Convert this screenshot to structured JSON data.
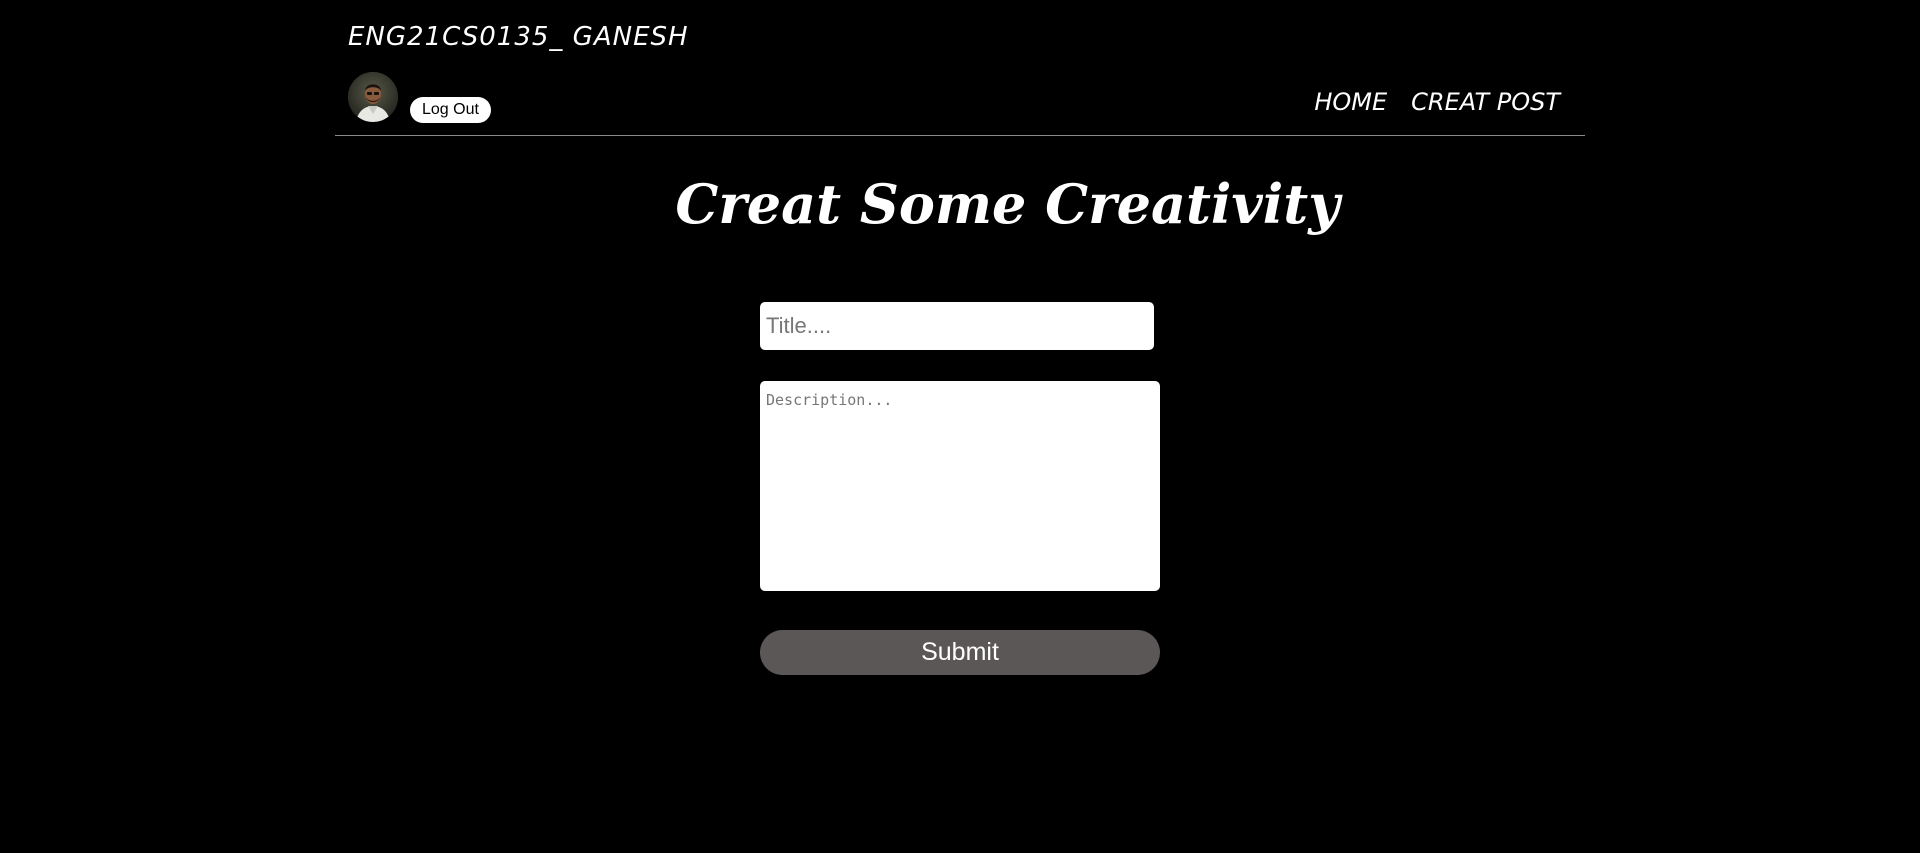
{
  "header": {
    "user_id": "ENG21CS0135_ GANESH",
    "logout_label": "Log Out",
    "nav": [
      {
        "label": "HOME"
      },
      {
        "label": "CREAT POST"
      }
    ]
  },
  "main": {
    "heading": "Creat Some Creativity",
    "title_placeholder": "Title....",
    "title_value": "",
    "description_placeholder": "Description...",
    "description_value": "",
    "submit_label": "Submit"
  },
  "icons": {
    "avatar": "user-avatar-photo"
  },
  "colors": {
    "background": "#000000",
    "text": "#ffffff",
    "submit_button": "#5c5757",
    "divider": "#8a8a8a"
  }
}
